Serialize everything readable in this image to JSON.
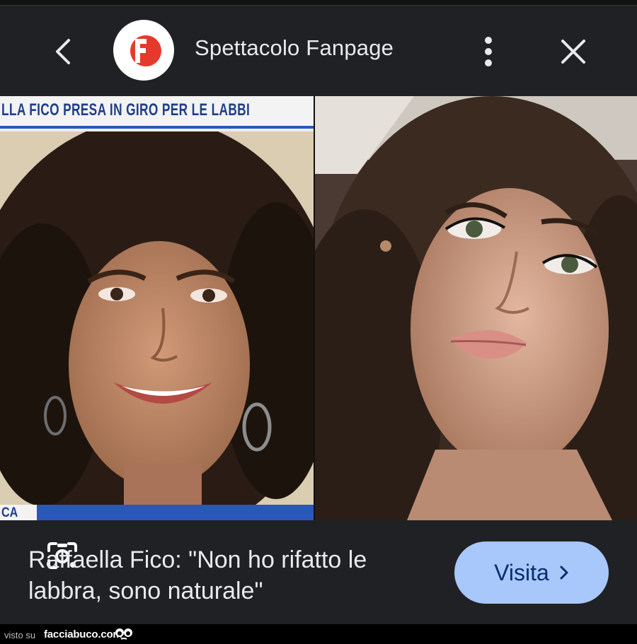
{
  "header": {
    "site_name": "Spettacolo Fanpage",
    "logo_icon": "fanpage-logo",
    "back_icon": "chevron-left-icon",
    "more_icon": "more-vert-icon",
    "close_icon": "close-icon"
  },
  "images": {
    "left": {
      "banner_text": "LLA FICO PRESA IN GIRO PER LE LABBI",
      "corner_text": "CA"
    },
    "lens_icon": "google-lens-icon"
  },
  "result": {
    "caption": "Raffaella Fico: \"Non ho rifatto le labbra, sono naturale\"",
    "visit_label": "Visita",
    "visit_icon": "chevron-right-icon"
  },
  "footer": {
    "visto_su": "visto su",
    "site": "facciabuco.com"
  },
  "colors": {
    "background": "#202124",
    "visit_button": "#a8c7fa",
    "brand_red": "#e53a2b"
  }
}
